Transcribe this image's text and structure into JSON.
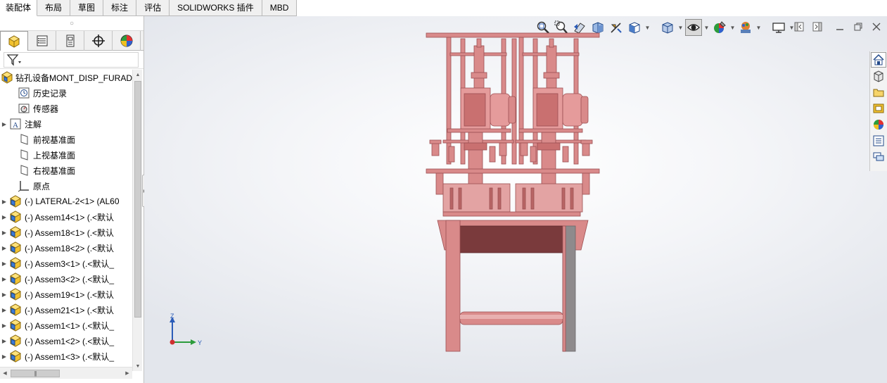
{
  "command_tabs": [
    {
      "label": "装配体",
      "active": true
    },
    {
      "label": "布局",
      "active": false
    },
    {
      "label": "草图",
      "active": false
    },
    {
      "label": "标注",
      "active": false
    },
    {
      "label": "评估",
      "active": false
    },
    {
      "label": "SOLIDWORKS 插件",
      "active": false
    },
    {
      "label": "MBD",
      "active": false
    }
  ],
  "hud_icons": [
    "zoom-to-fit-icon",
    "zoom-to-area-icon",
    "previous-view-icon",
    "section-view-icon",
    "dynamic-annotation-icon",
    "view-orientation-icon",
    "display-style-icon",
    "hide-show-items-icon",
    "edit-appearance-icon",
    "apply-scene-icon",
    "view-settings-icon"
  ],
  "feature_tree": {
    "root": "钻孔设备MONT_DISP_FURAD",
    "items": [
      {
        "label": "历史记录",
        "icon": "history-icon",
        "expandable": false
      },
      {
        "label": "传感器",
        "icon": "sensor-icon",
        "expandable": false
      },
      {
        "label": "注解",
        "icon": "annotation-icon",
        "expandable": true
      },
      {
        "label": "前视基准面",
        "icon": "plane-icon",
        "expandable": false
      },
      {
        "label": "上视基准面",
        "icon": "plane-icon",
        "expandable": false
      },
      {
        "label": "右视基准面",
        "icon": "plane-icon",
        "expandable": false
      },
      {
        "label": "原点",
        "icon": "origin-icon",
        "expandable": false
      },
      {
        "label": "(-) LATERAL-2<1> (AL60",
        "icon": "subassembly-icon",
        "expandable": true
      },
      {
        "label": "(-) Assem14<1> (.<默认",
        "icon": "subassembly-icon",
        "expandable": true
      },
      {
        "label": "(-) Assem18<1> (.<默认",
        "icon": "subassembly-icon",
        "expandable": true
      },
      {
        "label": "(-) Assem18<2> (.<默认",
        "icon": "subassembly-icon",
        "expandable": true
      },
      {
        "label": "(-) Assem3<1> (.<默认_",
        "icon": "subassembly-icon",
        "expandable": true
      },
      {
        "label": "(-) Assem3<2> (.<默认_",
        "icon": "subassembly-icon",
        "expandable": true
      },
      {
        "label": "(-) Assem19<1> (.<默认",
        "icon": "subassembly-icon",
        "expandable": true
      },
      {
        "label": "(-) Assem21<1> (.<默认",
        "icon": "subassembly-icon",
        "expandable": true
      },
      {
        "label": "(-) Assem1<1> (.<默认_",
        "icon": "subassembly-icon",
        "expandable": true
      },
      {
        "label": "(-) Assem1<2> (.<默认_",
        "icon": "subassembly-icon",
        "expandable": true
      },
      {
        "label": "(-) Assem1<3> (.<默认_",
        "icon": "subassembly-icon",
        "expandable": true
      }
    ]
  },
  "triad": {
    "z_label": "Z",
    "y_label": "Y"
  },
  "colors": {
    "model": "#d98a8a",
    "model_dark": "#9c4f52",
    "model_shadow": "#7a3a3c",
    "accent_blue": "#2b5cb8"
  }
}
